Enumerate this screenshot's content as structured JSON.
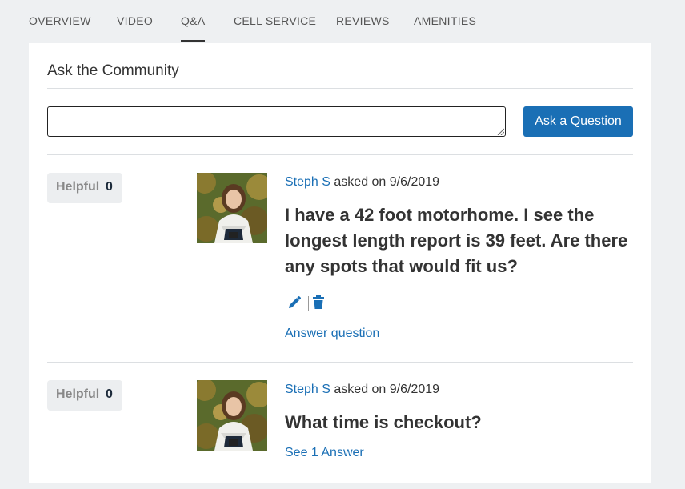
{
  "tabs": [
    {
      "label": "OVERVIEW"
    },
    {
      "label": "VIDEO"
    },
    {
      "label": "Q&A",
      "active": true
    },
    {
      "label": "CELL SERVICE"
    },
    {
      "label": "REVIEWS"
    },
    {
      "label": "AMENITIES"
    }
  ],
  "community": {
    "title": "Ask the Community",
    "input_value": "",
    "ask_button": "Ask a Question"
  },
  "questions": [
    {
      "helpful_label": "Helpful",
      "helpful_count": "0",
      "user": "Steph S",
      "asked_text": "asked on 9/6/2019",
      "question": "I have a 42 foot motorhome. I see the longest length report is 39 feet. Are there any spots that would fit us?",
      "action_link": "Answer question",
      "icons": [
        "pencil-icon",
        "trash-icon"
      ]
    },
    {
      "helpful_label": "Helpful",
      "helpful_count": "0",
      "user": "Steph S",
      "asked_text": "asked on 9/6/2019",
      "question": "What time is checkout?",
      "action_link": "See 1 Answer"
    }
  ],
  "colors": {
    "accent": "#1a6fb5",
    "background": "#eef0f2",
    "card": "#ffffff"
  }
}
